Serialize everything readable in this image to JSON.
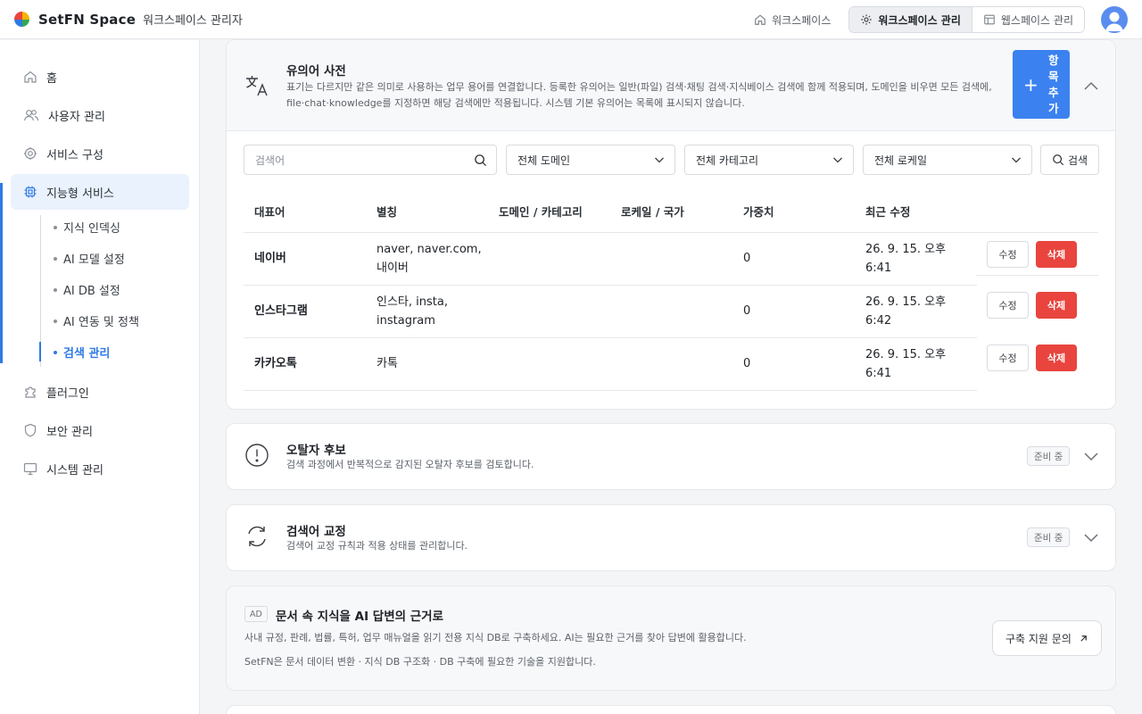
{
  "header": {
    "brand": "SetFN Space",
    "subtitle": "워크스페이스 관리자",
    "workspace_link": "워크스페이스",
    "seg_workspace_admin": "워크스페이스 관리",
    "seg_webspace_admin": "웹스페이스 관리"
  },
  "sidebar": {
    "items": [
      {
        "label": "홈",
        "icon": "home-icon"
      },
      {
        "label": "사용자 관리",
        "icon": "users-icon"
      },
      {
        "label": "서비스 구성",
        "icon": "gear-icon"
      },
      {
        "label": "지능형 서비스",
        "icon": "chip-icon"
      },
      {
        "label": "플러그인",
        "icon": "puzzle-icon"
      },
      {
        "label": "보안 관리",
        "icon": "shield-icon"
      },
      {
        "label": "시스템 관리",
        "icon": "monitor-icon"
      }
    ],
    "subitems": [
      "지식 인덱싱",
      "AI 모델 설정",
      "AI DB 설정",
      "AI 연동 및 정책",
      "검색 관리"
    ]
  },
  "synonym": {
    "title": "유의어 사전",
    "desc1": "표기는 다르지만 같은 의미로 사용하는 업무 용어를 연결합니다. 등록한 유의어는 일반(파일) 검색·채팅 검색·지식베이스 검색에 함께 적용되며, 도메인을 비우면 모든 검색에,",
    "desc2": "file·chat·knowledge를 지정하면 해당 검색에만 적용됩니다. 시스템 기본 유의어는 목록에 표시되지 않습니다.",
    "add_button": "항목 추가",
    "search_placeholder": "검색어",
    "domain_select": "전체 도메인",
    "category_select": "전체 카테고리",
    "locale_select": "전체 로케일",
    "search_button": "검색",
    "columns": [
      "대표어",
      "별칭",
      "도메인 / 카테고리",
      "로케일 / 국가",
      "가중치",
      "최근 수정"
    ],
    "rows": [
      {
        "term": "네이버",
        "alias1": "naver, naver.com,",
        "alias2": "내이버",
        "weight": "0",
        "date1": "26. 9. 15. 오후",
        "date2": "6:41"
      },
      {
        "term": "인스타그램",
        "alias1": "인스타, insta,",
        "alias2": "instagram",
        "weight": "0",
        "date1": "26. 9. 15. 오후",
        "date2": "6:42"
      },
      {
        "term": "카카오톡",
        "alias1": "카톡",
        "alias2": "",
        "weight": "0",
        "date1": "26. 9. 15. 오후",
        "date2": "6:41"
      }
    ],
    "edit_label": "수정",
    "delete_label": "삭제"
  },
  "typo": {
    "title": "오탈자 후보",
    "desc": "검색 과정에서 반복적으로 감지된 오탈자 후보를 검토합니다.",
    "badge": "준비 중"
  },
  "correction": {
    "title": "검색어 교정",
    "desc": "검색어 교정 규칙과 적용 상태를 관리합니다.",
    "badge": "준비 중"
  },
  "ad": {
    "tag": "AD",
    "title": "문서 속 지식을 AI 답변의 근거로",
    "line1": "사내 규정, 판례, 법률, 특허, 업무 매뉴얼을 읽기 전용 지식 DB로 구축하세요. AI는 필요한 근거를 찾아 답변에 활용합니다.",
    "line2": "SetFN은 문서 데이터 변환 · 지식 DB 구조화 · DB 구축에 필요한 기술을 지원합니다.",
    "button": "구축 지원 문의"
  }
}
